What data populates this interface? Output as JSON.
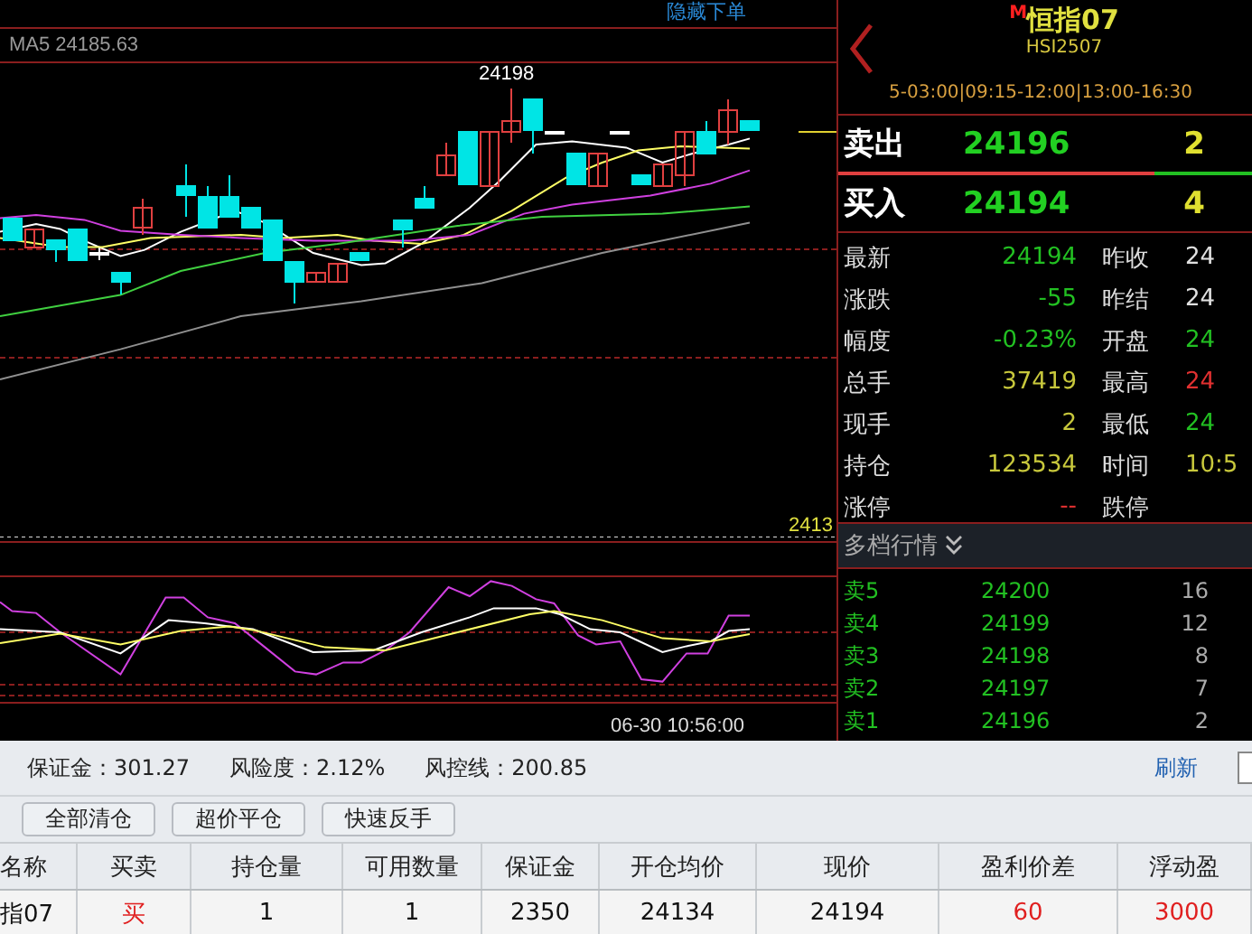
{
  "chart": {
    "hide_order_link": "隐藏下单",
    "ma_label": "MA5 24185.63",
    "high_label": "24198",
    "price_label": "2413",
    "time_label": "06-30 10:56:00"
  },
  "instrument": {
    "badge": "M",
    "name": "恒指07",
    "code": "HSI2507",
    "sessions": "5-03:00|09:15-12:00|13:00-16:30"
  },
  "ask": {
    "label": "卖出",
    "price": "24196",
    "volume": "2"
  },
  "pressure": {
    "level": 0.76
  },
  "bid": {
    "label": "买入",
    "price": "24194",
    "volume": "4"
  },
  "quotes": [
    {
      "left": {
        "label": "最新",
        "value": "24194",
        "color": "#22c022"
      },
      "right": {
        "label": "昨收",
        "value": "24",
        "color": "#e0e0e0"
      }
    },
    {
      "left": {
        "label": "涨跌",
        "value": "-55",
        "color": "#22c022"
      },
      "right": {
        "label": "昨结",
        "value": "24",
        "color": "#e0e0e0"
      }
    },
    {
      "left": {
        "label": "幅度",
        "value": "-0.23%",
        "color": "#22c022"
      },
      "right": {
        "label": "开盘",
        "value": "24",
        "color": "#22c022"
      }
    },
    {
      "left": {
        "label": "总手",
        "value": "37419",
        "color": "#c8c83c"
      },
      "right": {
        "label": "最高",
        "value": "24",
        "color": "#e03030"
      }
    },
    {
      "left": {
        "label": "现手",
        "value": "2",
        "color": "#c8c83c"
      },
      "right": {
        "label": "最低",
        "value": "24",
        "color": "#22c022"
      }
    },
    {
      "left": {
        "label": "持仓",
        "value": "123534",
        "color": "#c8c83c"
      },
      "right": {
        "label": "时间",
        "value": "10:5",
        "color": "#c8c83c"
      }
    },
    {
      "left": {
        "label": "涨停",
        "value": "--",
        "color": "#e03030"
      },
      "right": {
        "label": "跌停"
      }
    }
  ],
  "depth": {
    "title": "多档行情",
    "levels": [
      {
        "label": "卖5",
        "price": "24200",
        "volume": "16"
      },
      {
        "label": "卖4",
        "price": "24199",
        "volume": "12"
      },
      {
        "label": "卖3",
        "price": "24198",
        "volume": "8"
      },
      {
        "label": "卖2",
        "price": "24197",
        "volume": "7"
      },
      {
        "label": "卖1",
        "price": "24196",
        "volume": "2"
      }
    ]
  },
  "account": {
    "fields": [
      "保证金：301.27",
      "风险度：2.12%",
      "风控线：200.85"
    ],
    "refresh": "刷新"
  },
  "actions": [
    "全部清仓",
    "超价平仓",
    "快速反手"
  ],
  "positions": {
    "columns": [
      "名称",
      "买卖",
      "持仓量",
      "可用数量",
      "保证金",
      "开仓均价",
      "现价",
      "盈利价差",
      "浮动盈"
    ],
    "rows": [
      {
        "cells": [
          {
            "text": "指07",
            "color": "#111111"
          },
          {
            "text": "买",
            "color": "#e02020"
          },
          {
            "text": "1",
            "color": "#111111"
          },
          {
            "text": "1",
            "color": "#111111"
          },
          {
            "text": "2350",
            "color": "#111111"
          },
          {
            "text": "24134",
            "color": "#111111"
          },
          {
            "text": "24194",
            "color": "#111111"
          },
          {
            "text": "60",
            "color": "#e02020"
          },
          {
            "text": "3000",
            "color": "#e02020"
          }
        ]
      }
    ]
  }
}
